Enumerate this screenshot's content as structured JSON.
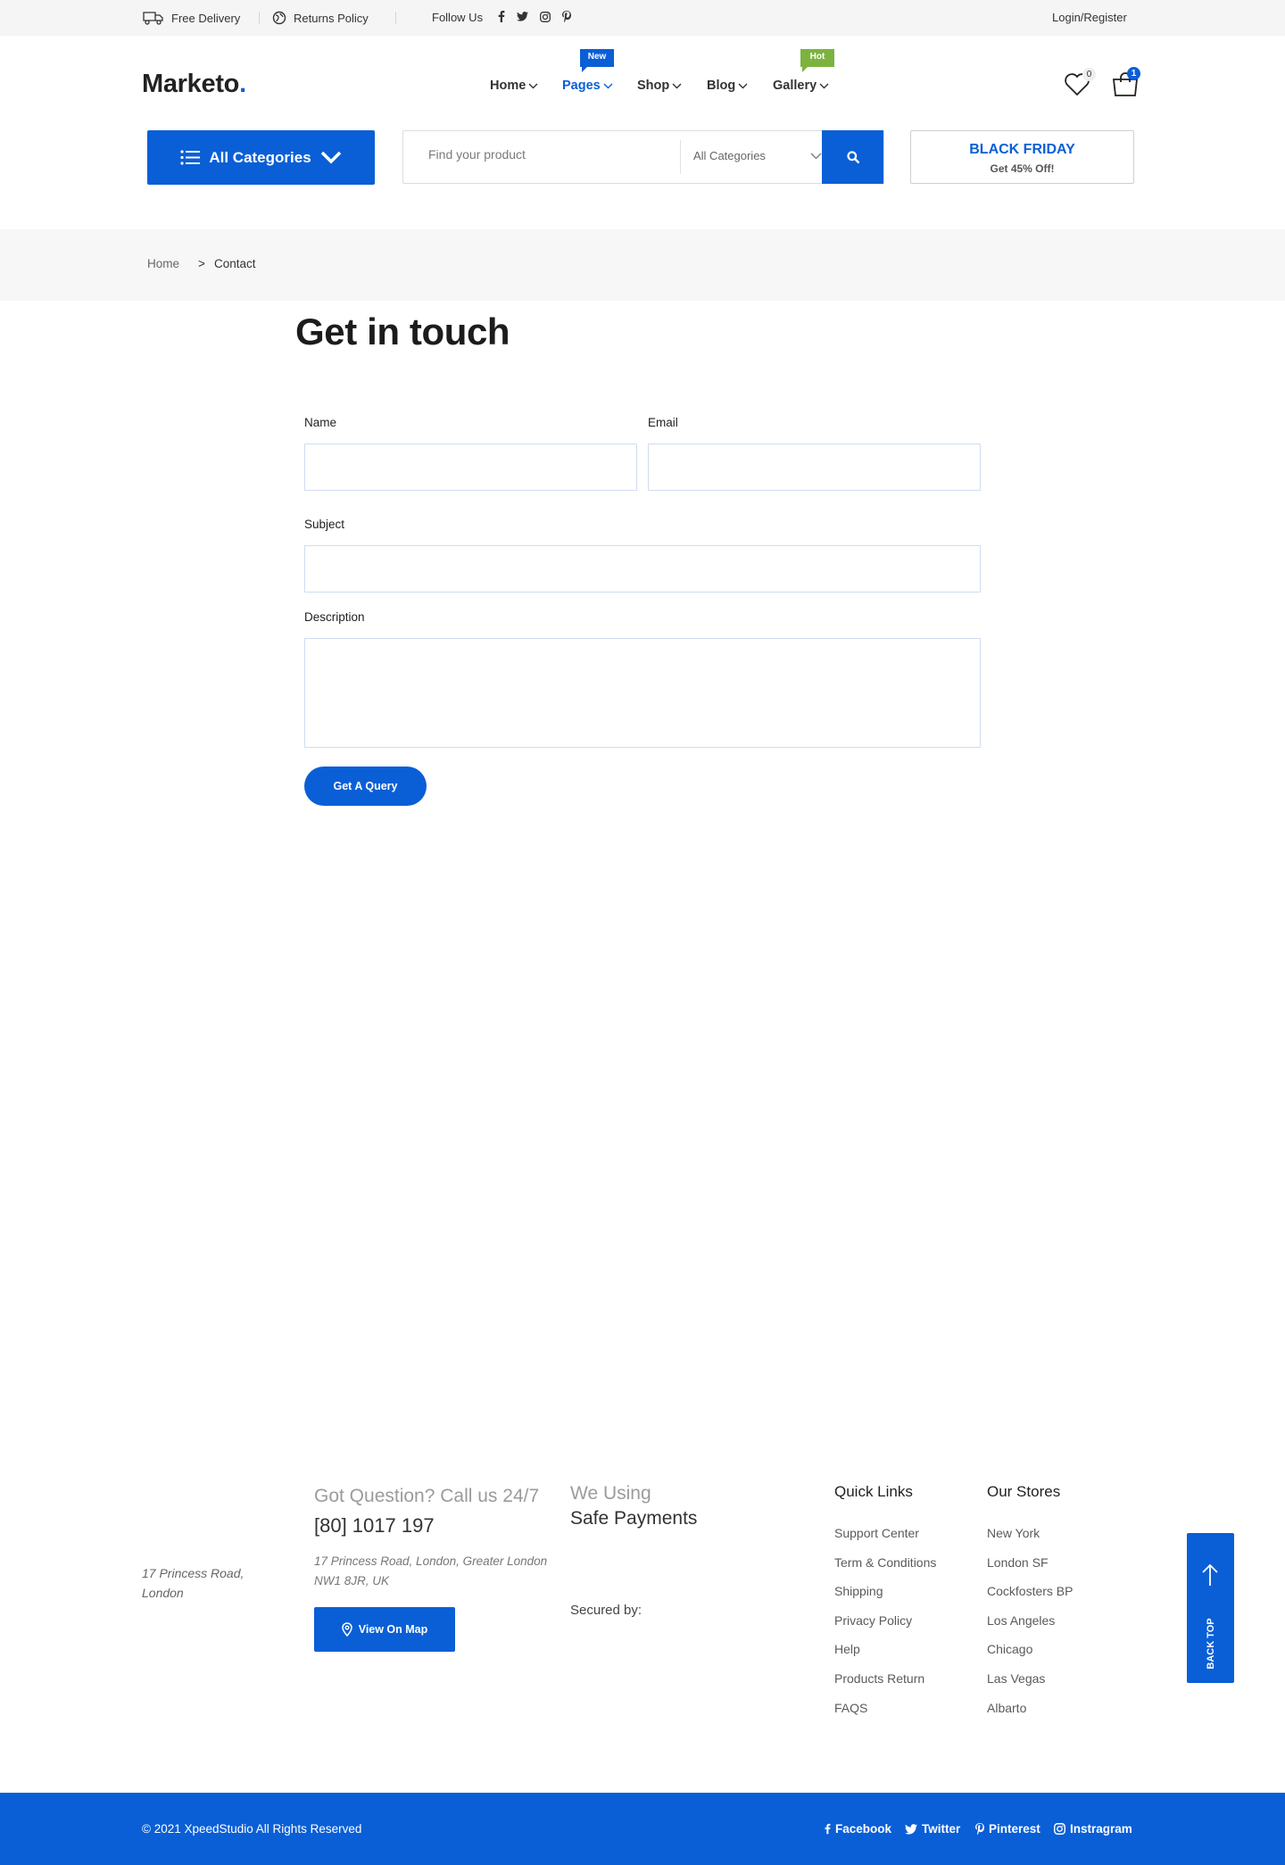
{
  "topbar": {
    "free_delivery": "Free Delivery",
    "returns_policy": "Returns Policy",
    "follow_us": "Follow Us",
    "social_icons": [
      "facebook-icon",
      "twitter-icon",
      "instagram-icon",
      "pinterest-icon"
    ],
    "login": "Login/Register"
  },
  "header": {
    "logo_text": "Marketo",
    "logo_dot": ".",
    "nav": [
      "Home",
      "Pages",
      "Shop",
      "Blog",
      "Gallery"
    ],
    "active_nav": "Pages",
    "badge_new": "New",
    "badge_hot": "Hot",
    "wishlist_count": "0",
    "cart_count": "1"
  },
  "search": {
    "all_categories": "All Categories",
    "placeholder": "Find your product",
    "category_select": "All Categories"
  },
  "promo": {
    "title": "BLACK FRIDAY",
    "subtitle": "Get 45% Off!"
  },
  "breadcrumb": {
    "home": "Home",
    "separator": ">",
    "current": "Contact"
  },
  "contact_form": {
    "title": "Get in touch",
    "name_label": "Name",
    "email_label": "Email",
    "subject_label": "Subject",
    "description_label": "Description",
    "name_value": "",
    "email_value": "",
    "subject_value": "",
    "description_value": "",
    "submit": "Get A Query"
  },
  "footer": {
    "address_short_1": "17 Princess Road,",
    "address_short_2": "London",
    "question": "Got Question? Call us 24/7",
    "phone": "[80] 1017 197",
    "address_long_1": "17 Princess Road, London, Greater London",
    "address_long_2": "NW1 8JR, UK",
    "view_map": "View On Map",
    "we_using": "We Using",
    "safe_payments": "Safe Payments",
    "secured_by": "Secured by:",
    "quick_links_title": "Quick Links",
    "quick_links": [
      "Support Center",
      "Term & Conditions",
      "Shipping",
      "Privacy Policy",
      "Help",
      "Products Return",
      "FAQS"
    ],
    "stores_title": "Our Stores",
    "stores": [
      "New York",
      "London SF",
      "Cockfosters BP",
      "Los Angeles",
      "Chicago",
      "Las Vegas",
      "Albarto"
    ],
    "back_top": "BACK TOP"
  },
  "bottom": {
    "copyright": "© 2021 XpeedStudio All Rights Reserved",
    "social": [
      "Facebook",
      "Twitter",
      "Pinterest",
      "Instragram"
    ]
  },
  "colors": {
    "accent": "#0a5fd6",
    "hot": "#7cb33e",
    "topbar_bg": "#f5f5f5"
  }
}
